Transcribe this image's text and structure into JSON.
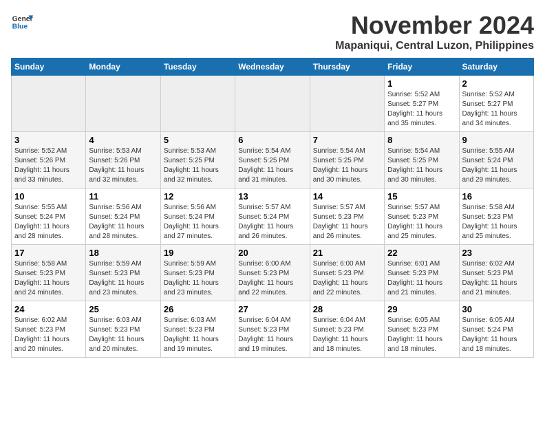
{
  "logo": {
    "line1": "General",
    "line2": "Blue"
  },
  "title": "November 2024",
  "location": "Mapaniqui, Central Luzon, Philippines",
  "weekdays": [
    "Sunday",
    "Monday",
    "Tuesday",
    "Wednesday",
    "Thursday",
    "Friday",
    "Saturday"
  ],
  "weeks": [
    [
      {
        "day": "",
        "info": ""
      },
      {
        "day": "",
        "info": ""
      },
      {
        "day": "",
        "info": ""
      },
      {
        "day": "",
        "info": ""
      },
      {
        "day": "",
        "info": ""
      },
      {
        "day": "1",
        "info": "Sunrise: 5:52 AM\nSunset: 5:27 PM\nDaylight: 11 hours\nand 35 minutes."
      },
      {
        "day": "2",
        "info": "Sunrise: 5:52 AM\nSunset: 5:27 PM\nDaylight: 11 hours\nand 34 minutes."
      }
    ],
    [
      {
        "day": "3",
        "info": "Sunrise: 5:52 AM\nSunset: 5:26 PM\nDaylight: 11 hours\nand 33 minutes."
      },
      {
        "day": "4",
        "info": "Sunrise: 5:53 AM\nSunset: 5:26 PM\nDaylight: 11 hours\nand 32 minutes."
      },
      {
        "day": "5",
        "info": "Sunrise: 5:53 AM\nSunset: 5:25 PM\nDaylight: 11 hours\nand 32 minutes."
      },
      {
        "day": "6",
        "info": "Sunrise: 5:54 AM\nSunset: 5:25 PM\nDaylight: 11 hours\nand 31 minutes."
      },
      {
        "day": "7",
        "info": "Sunrise: 5:54 AM\nSunset: 5:25 PM\nDaylight: 11 hours\nand 30 minutes."
      },
      {
        "day": "8",
        "info": "Sunrise: 5:54 AM\nSunset: 5:25 PM\nDaylight: 11 hours\nand 30 minutes."
      },
      {
        "day": "9",
        "info": "Sunrise: 5:55 AM\nSunset: 5:24 PM\nDaylight: 11 hours\nand 29 minutes."
      }
    ],
    [
      {
        "day": "10",
        "info": "Sunrise: 5:55 AM\nSunset: 5:24 PM\nDaylight: 11 hours\nand 28 minutes."
      },
      {
        "day": "11",
        "info": "Sunrise: 5:56 AM\nSunset: 5:24 PM\nDaylight: 11 hours\nand 28 minutes."
      },
      {
        "day": "12",
        "info": "Sunrise: 5:56 AM\nSunset: 5:24 PM\nDaylight: 11 hours\nand 27 minutes."
      },
      {
        "day": "13",
        "info": "Sunrise: 5:57 AM\nSunset: 5:24 PM\nDaylight: 11 hours\nand 26 minutes."
      },
      {
        "day": "14",
        "info": "Sunrise: 5:57 AM\nSunset: 5:23 PM\nDaylight: 11 hours\nand 26 minutes."
      },
      {
        "day": "15",
        "info": "Sunrise: 5:57 AM\nSunset: 5:23 PM\nDaylight: 11 hours\nand 25 minutes."
      },
      {
        "day": "16",
        "info": "Sunrise: 5:58 AM\nSunset: 5:23 PM\nDaylight: 11 hours\nand 25 minutes."
      }
    ],
    [
      {
        "day": "17",
        "info": "Sunrise: 5:58 AM\nSunset: 5:23 PM\nDaylight: 11 hours\nand 24 minutes."
      },
      {
        "day": "18",
        "info": "Sunrise: 5:59 AM\nSunset: 5:23 PM\nDaylight: 11 hours\nand 23 minutes."
      },
      {
        "day": "19",
        "info": "Sunrise: 5:59 AM\nSunset: 5:23 PM\nDaylight: 11 hours\nand 23 minutes."
      },
      {
        "day": "20",
        "info": "Sunrise: 6:00 AM\nSunset: 5:23 PM\nDaylight: 11 hours\nand 22 minutes."
      },
      {
        "day": "21",
        "info": "Sunrise: 6:00 AM\nSunset: 5:23 PM\nDaylight: 11 hours\nand 22 minutes."
      },
      {
        "day": "22",
        "info": "Sunrise: 6:01 AM\nSunset: 5:23 PM\nDaylight: 11 hours\nand 21 minutes."
      },
      {
        "day": "23",
        "info": "Sunrise: 6:02 AM\nSunset: 5:23 PM\nDaylight: 11 hours\nand 21 minutes."
      }
    ],
    [
      {
        "day": "24",
        "info": "Sunrise: 6:02 AM\nSunset: 5:23 PM\nDaylight: 11 hours\nand 20 minutes."
      },
      {
        "day": "25",
        "info": "Sunrise: 6:03 AM\nSunset: 5:23 PM\nDaylight: 11 hours\nand 20 minutes."
      },
      {
        "day": "26",
        "info": "Sunrise: 6:03 AM\nSunset: 5:23 PM\nDaylight: 11 hours\nand 19 minutes."
      },
      {
        "day": "27",
        "info": "Sunrise: 6:04 AM\nSunset: 5:23 PM\nDaylight: 11 hours\nand 19 minutes."
      },
      {
        "day": "28",
        "info": "Sunrise: 6:04 AM\nSunset: 5:23 PM\nDaylight: 11 hours\nand 18 minutes."
      },
      {
        "day": "29",
        "info": "Sunrise: 6:05 AM\nSunset: 5:23 PM\nDaylight: 11 hours\nand 18 minutes."
      },
      {
        "day": "30",
        "info": "Sunrise: 6:05 AM\nSunset: 5:24 PM\nDaylight: 11 hours\nand 18 minutes."
      }
    ]
  ]
}
